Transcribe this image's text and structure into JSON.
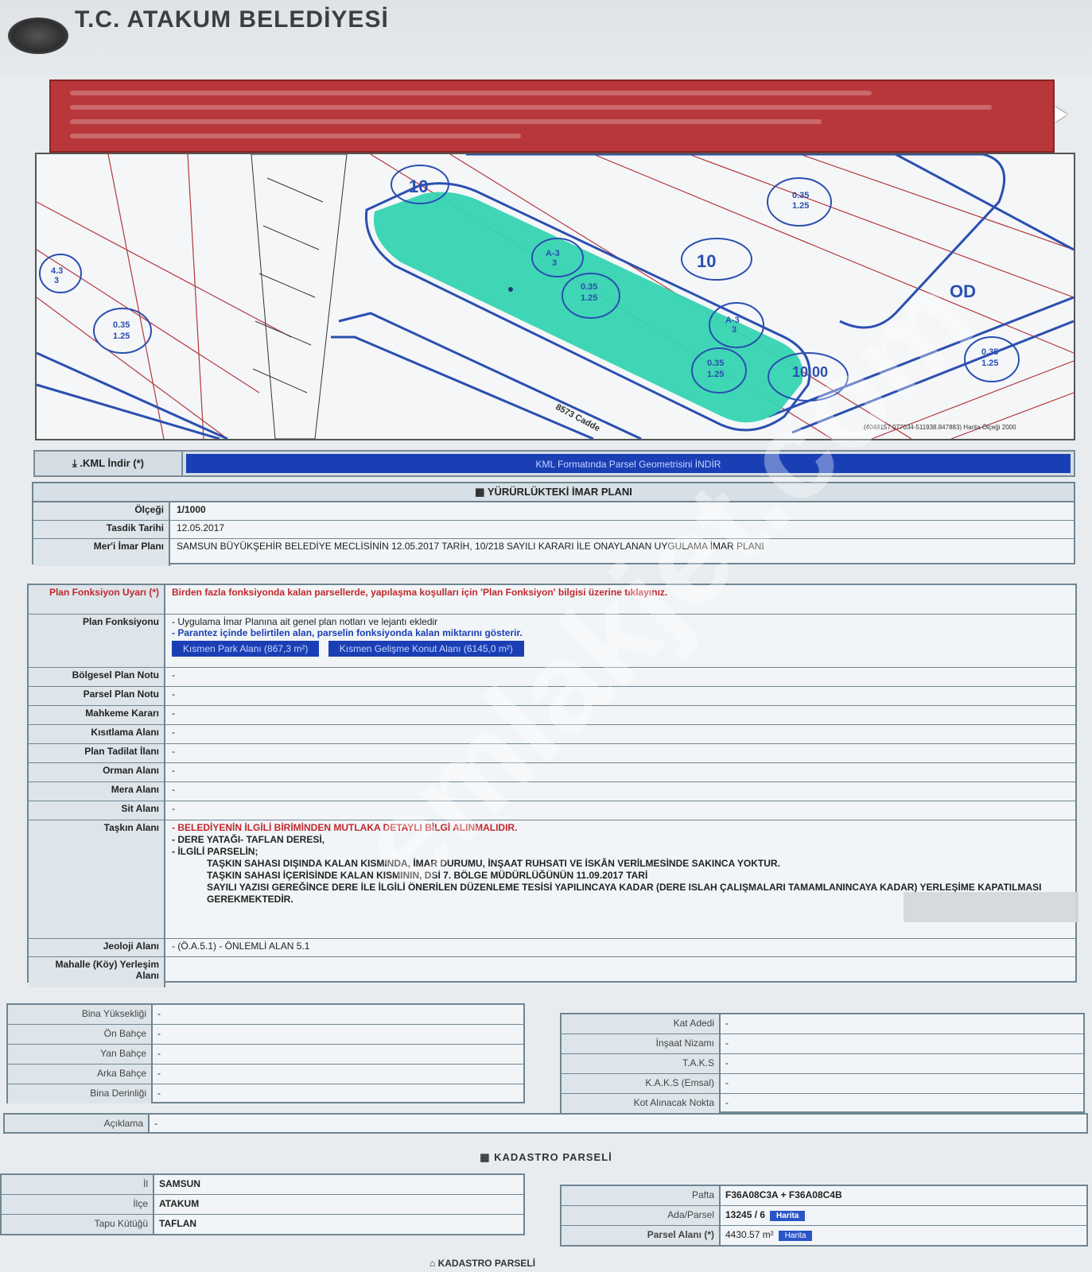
{
  "header": {
    "title": "T.C. ATAKUM BELEDİYESİ"
  },
  "colors": {
    "accent": "#1a3fb5",
    "warning": "#b8373a",
    "parcel": "#35d4b2",
    "alert_text": "#c0282c"
  },
  "map": {
    "labels": [
      "10",
      "10",
      "OD",
      "0.35 1.25",
      "0.35 1.25",
      "0.35 1.25",
      "0.35 1.25",
      "0.35 1.25",
      "A-3 3",
      "A-3 3",
      "8573 Cadde",
      "10.00",
      "4.3 3"
    ],
    "watermark": "emlakjet.com"
  },
  "kml": {
    "label": ".KML İndir (*)",
    "button": "KML Formatında Parsel Geometrisini İNDİR"
  },
  "imar": {
    "title": "YÜRÜRLÜKTEKİ İMAR PLANI",
    "rows": [
      {
        "label": "Ölçeği",
        "value": "1/1000"
      },
      {
        "label": "Tasdik Tarihi",
        "value": "12.05.2017"
      },
      {
        "label": "Mer'i İmar Planı",
        "value": "SAMSUN BÜYÜKŞEHİR BELEDİYE MECLİSİNİN 12.05.2017 TARİH, 10/218 SAYILI KARARI İLE ONAYLANAN UYGULAMA İMAR PLANI"
      }
    ]
  },
  "detail": {
    "uyari_label": "Plan Fonksiyon Uyarı (*)",
    "uyari_value": "Birden fazla fonksiyonda kalan parsellerde, yapılaşma koşulları için 'Plan Fonksiyon' bilgisi üzerine tıklayınız.",
    "fonksiyon_label": "Plan Fonksiyonu",
    "fonksiyon_note1": "- Uygulama İmar Planına ait genel plan notları ve lejantı ekledir",
    "fonksiyon_note2": "- Parantez içinde belirtilen alan, parselin fonksiyonda kalan miktarını gösterir.",
    "chips": [
      "Kısmen Park Alanı (867,3 m²)",
      "Kısmen Gelişme Konut Alanı (6145,0 m²)"
    ],
    "rows": [
      {
        "label": "Bölgesel Plan Notu",
        "value": "-"
      },
      {
        "label": "Parsel Plan Notu",
        "value": "-"
      },
      {
        "label": "Mahkeme Kararı",
        "value": "-"
      },
      {
        "label": "Kısıtlama Alanı",
        "value": "-"
      },
      {
        "label": "Plan Tadilat İlanı",
        "value": "-"
      },
      {
        "label": "Orman Alanı",
        "value": "-"
      },
      {
        "label": "Mera Alanı",
        "value": "-"
      },
      {
        "label": "Sit Alanı",
        "value": "-"
      }
    ],
    "taskin_label": "Taşkın Alanı",
    "taskin_lines": [
      "- BELEDİYENİN İLGİLİ BİRİMİNDEN MUTLAKA DETAYLI BİLGİ ALINMALIDIR.",
      "- DERE YATAĞI- TAFLAN DERESİ,",
      "- İLGİLİ PARSELİN;",
      "TAŞKIN SAHASI DIŞINDA KALAN KISMINDA, İMAR DURUMU, İNŞAAT RUHSATI VE İSKÂN VERİLMESİNDE SAKINCA YOKTUR.",
      "TAŞKIN SAHASI İÇERİSİNDE KALAN KISMININ, DSİ 7. BÖLGE MÜDÜRLÜĞÜNÜN 11.09.2017 TARİ",
      "SAYILI YAZISI GEREĞİNCE DERE İLE İLGİLİ ÖNERİLEN DÜZENLEME TESİSİ YAPILINCAYA KADAR (DERE ISLAH ÇALIŞMALARI TAMAMLANINCAYA KADAR) YERLEŞİME KAPATILMASI GEREKMEKTEDİR."
    ],
    "jeoloji_label": "Jeoloji Alanı",
    "jeoloji_value": "- (Ö.A.5.1) - ÖNLEMLİ ALAN 5.1",
    "mahalle_label": "Mahalle (Köy) Yerleşim Alanı",
    "mahalle_value": ""
  },
  "yapi_left": [
    {
      "label": "Bina Yüksekliği",
      "value": "-"
    },
    {
      "label": "Ön Bahçe",
      "value": "-"
    },
    {
      "label": "Yan Bahçe",
      "value": "-"
    },
    {
      "label": "Arka Bahçe",
      "value": "-"
    },
    {
      "label": "Bina Derinliği",
      "value": "-"
    }
  ],
  "yapi_right": [
    {
      "label": "Kat Adedi",
      "value": "-"
    },
    {
      "label": "İnşaat Nizamı",
      "value": "-"
    },
    {
      "label": "T.A.K.S",
      "value": "-"
    },
    {
      "label": "K.A.K.S (Emsal)",
      "value": "-"
    },
    {
      "label": "Kot Alınacak Nokta",
      "value": "-"
    }
  ],
  "aciklama": {
    "label": "Açıklama",
    "value": "-"
  },
  "kadastro": {
    "title": "KADASTRO PARSELİ",
    "left": [
      {
        "label": "İl",
        "value": "SAMSUN"
      },
      {
        "label": "İlçe",
        "value": "ATAKUM"
      },
      {
        "label": "Tapu Kütüğü",
        "value": "TAFLAN"
      }
    ],
    "right": [
      {
        "label": "Pafta",
        "value": "F36A08C3A + F36A08C4B"
      },
      {
        "label": "Ada/Parsel",
        "value": "13245 / 6"
      },
      {
        "label": "Parsel Alanı (*)",
        "value": "4430.57 m²"
      }
    ],
    "ada_btn": "Harita",
    "alan_btn": "Harita",
    "footer": "KADASTRO PARSELİ"
  }
}
